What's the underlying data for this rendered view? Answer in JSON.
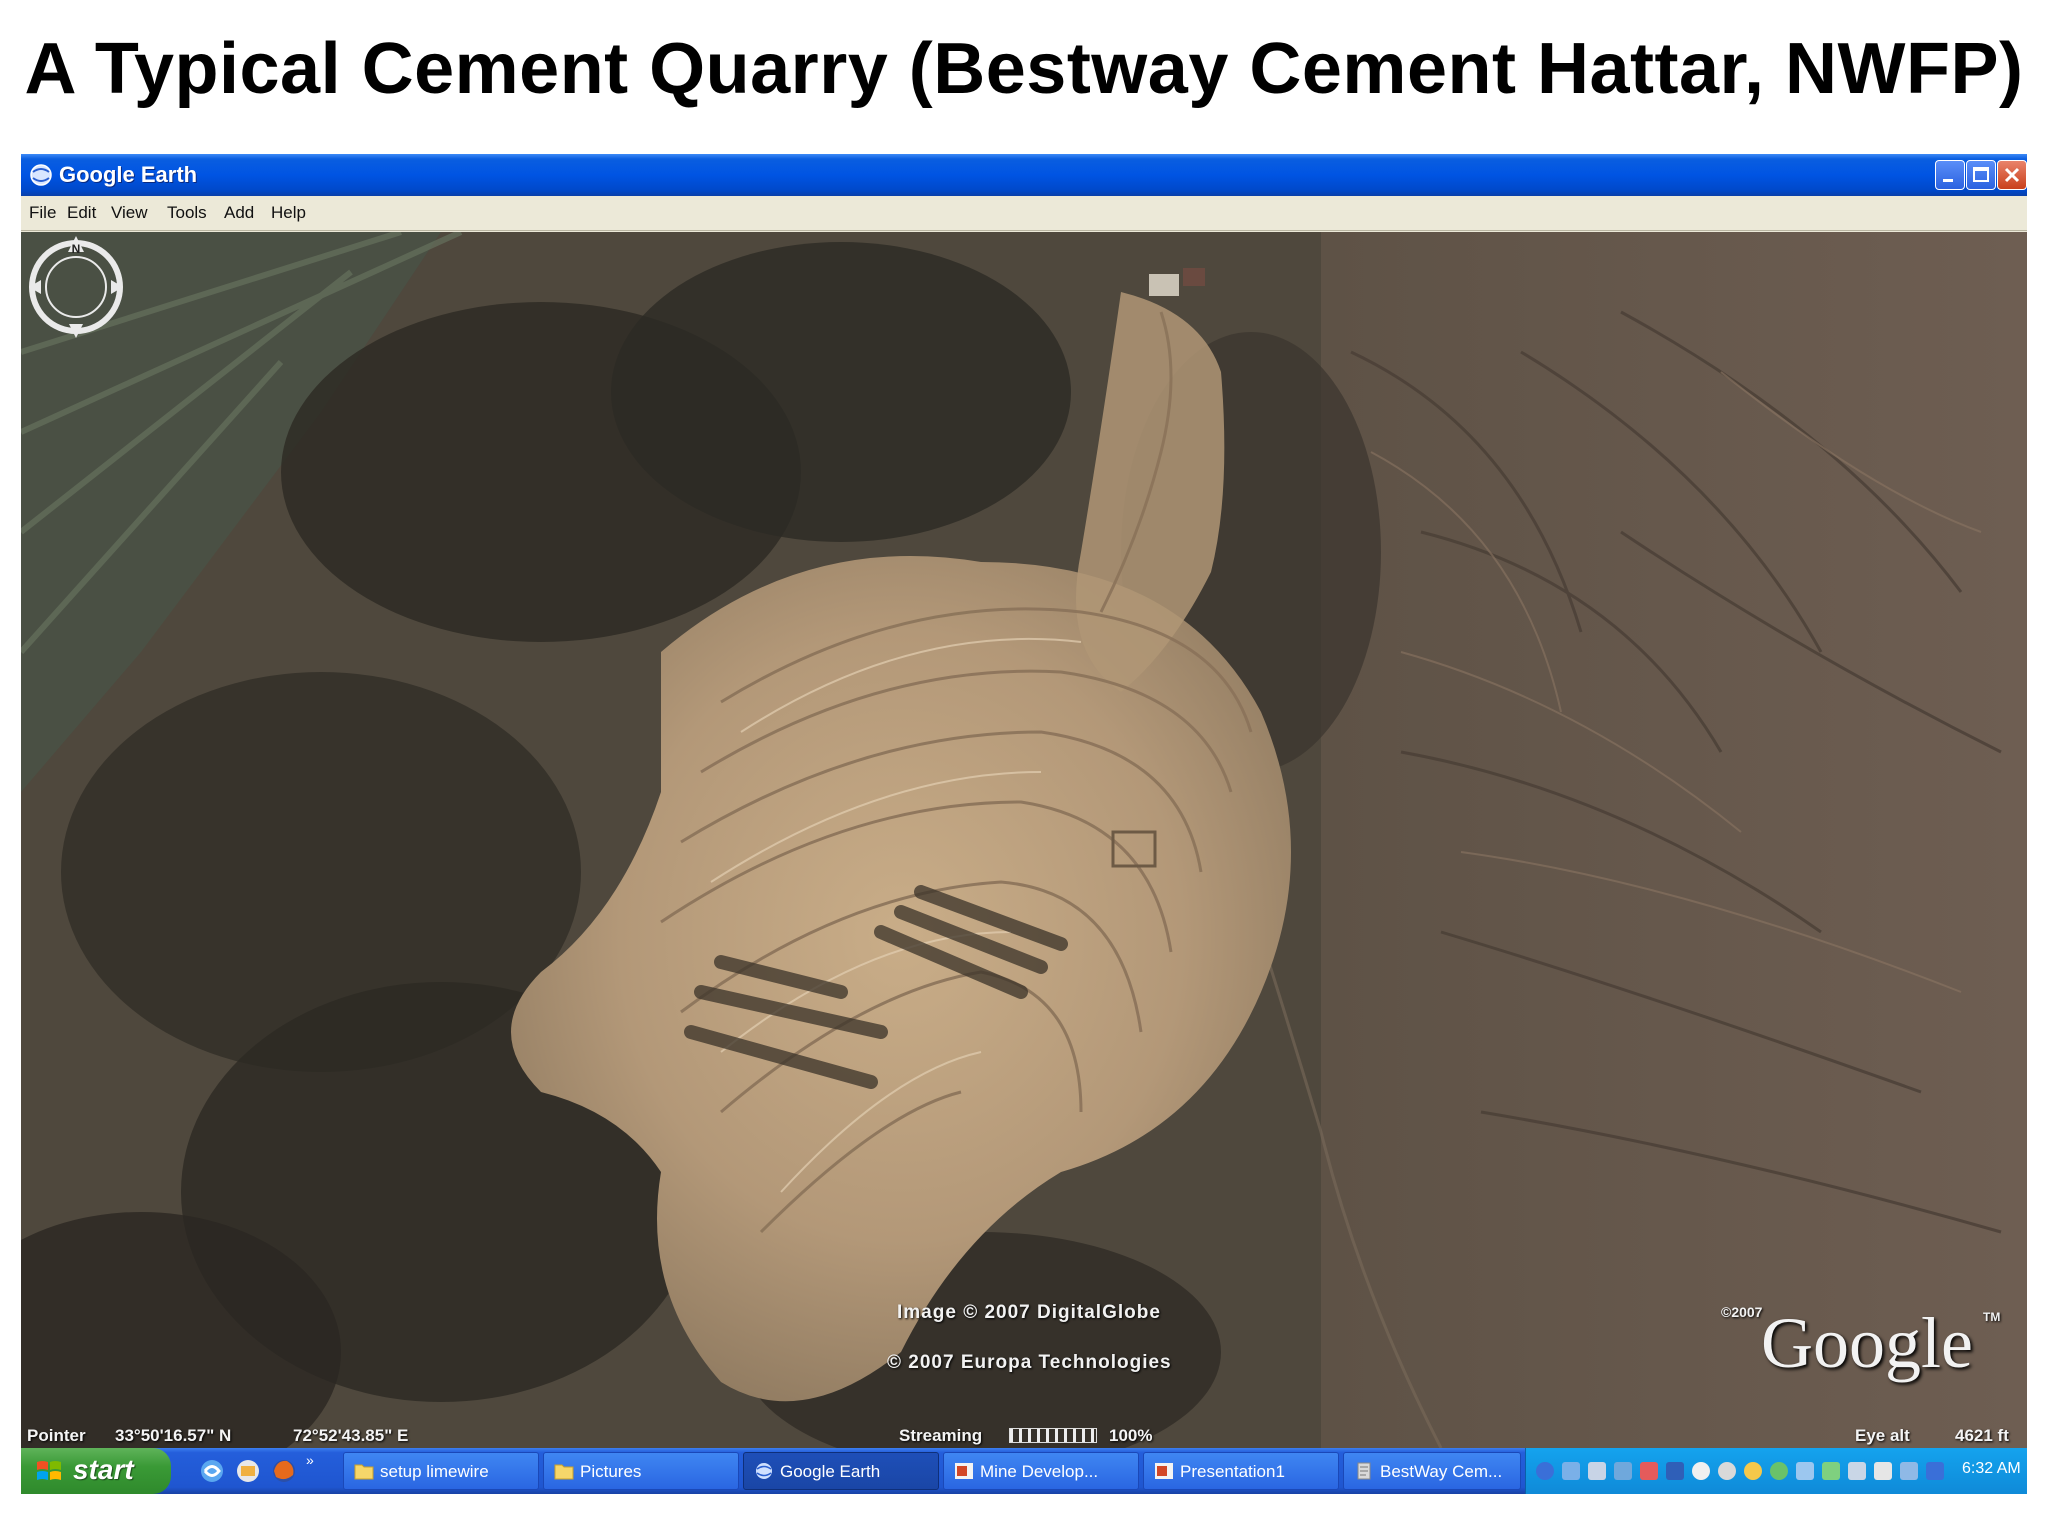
{
  "slide": {
    "title": "A Typical Cement Quarry (Bestway Cement Hattar, NWFP)"
  },
  "window": {
    "title": "Google Earth",
    "icon": "google-earth-icon",
    "controls": [
      "minimize-icon",
      "maximize-icon",
      "close-icon"
    ]
  },
  "menu": {
    "items": [
      "File",
      "Edit",
      "View",
      "Tools",
      "Add",
      "Help"
    ]
  },
  "map": {
    "credit_image": "Image © 2007 DigitalGlobe",
    "credit_europa": "© 2007 Europa Technologies",
    "logo_year": "©2007",
    "logo": "Google",
    "logo_tm": "TM",
    "compass_label": "N"
  },
  "status": {
    "pointer_label": "Pointer",
    "latitude": "33°50'16.57\" N",
    "longitude": "72°52'43.85\" E",
    "streaming_label": "Streaming",
    "streaming_percent": "100%",
    "eye_alt_label": "Eye alt",
    "eye_alt_value": "4621 ft"
  },
  "taskbar": {
    "start_label": "start",
    "quick_launch": [
      "ie-icon",
      "mail-icon",
      "firefox-icon"
    ],
    "buttons": [
      {
        "label": "setup limewire",
        "icon": "folder-icon"
      },
      {
        "label": "Pictures",
        "icon": "folder-icon"
      },
      {
        "label": "Google Earth",
        "icon": "google-earth-icon",
        "active": true
      },
      {
        "label": "Mine Develop...",
        "icon": "powerpoint-icon"
      },
      {
        "label": "Presentation1",
        "icon": "powerpoint-icon"
      },
      {
        "label": "BestWay Cem...",
        "icon": "document-icon"
      }
    ],
    "clock": "6:32 AM"
  },
  "colors": {
    "titlebar": "#0054e3",
    "start_green": "#3a9a36",
    "tray_blue": "#0f8ad8",
    "quarry_tan": "#b89c78"
  }
}
